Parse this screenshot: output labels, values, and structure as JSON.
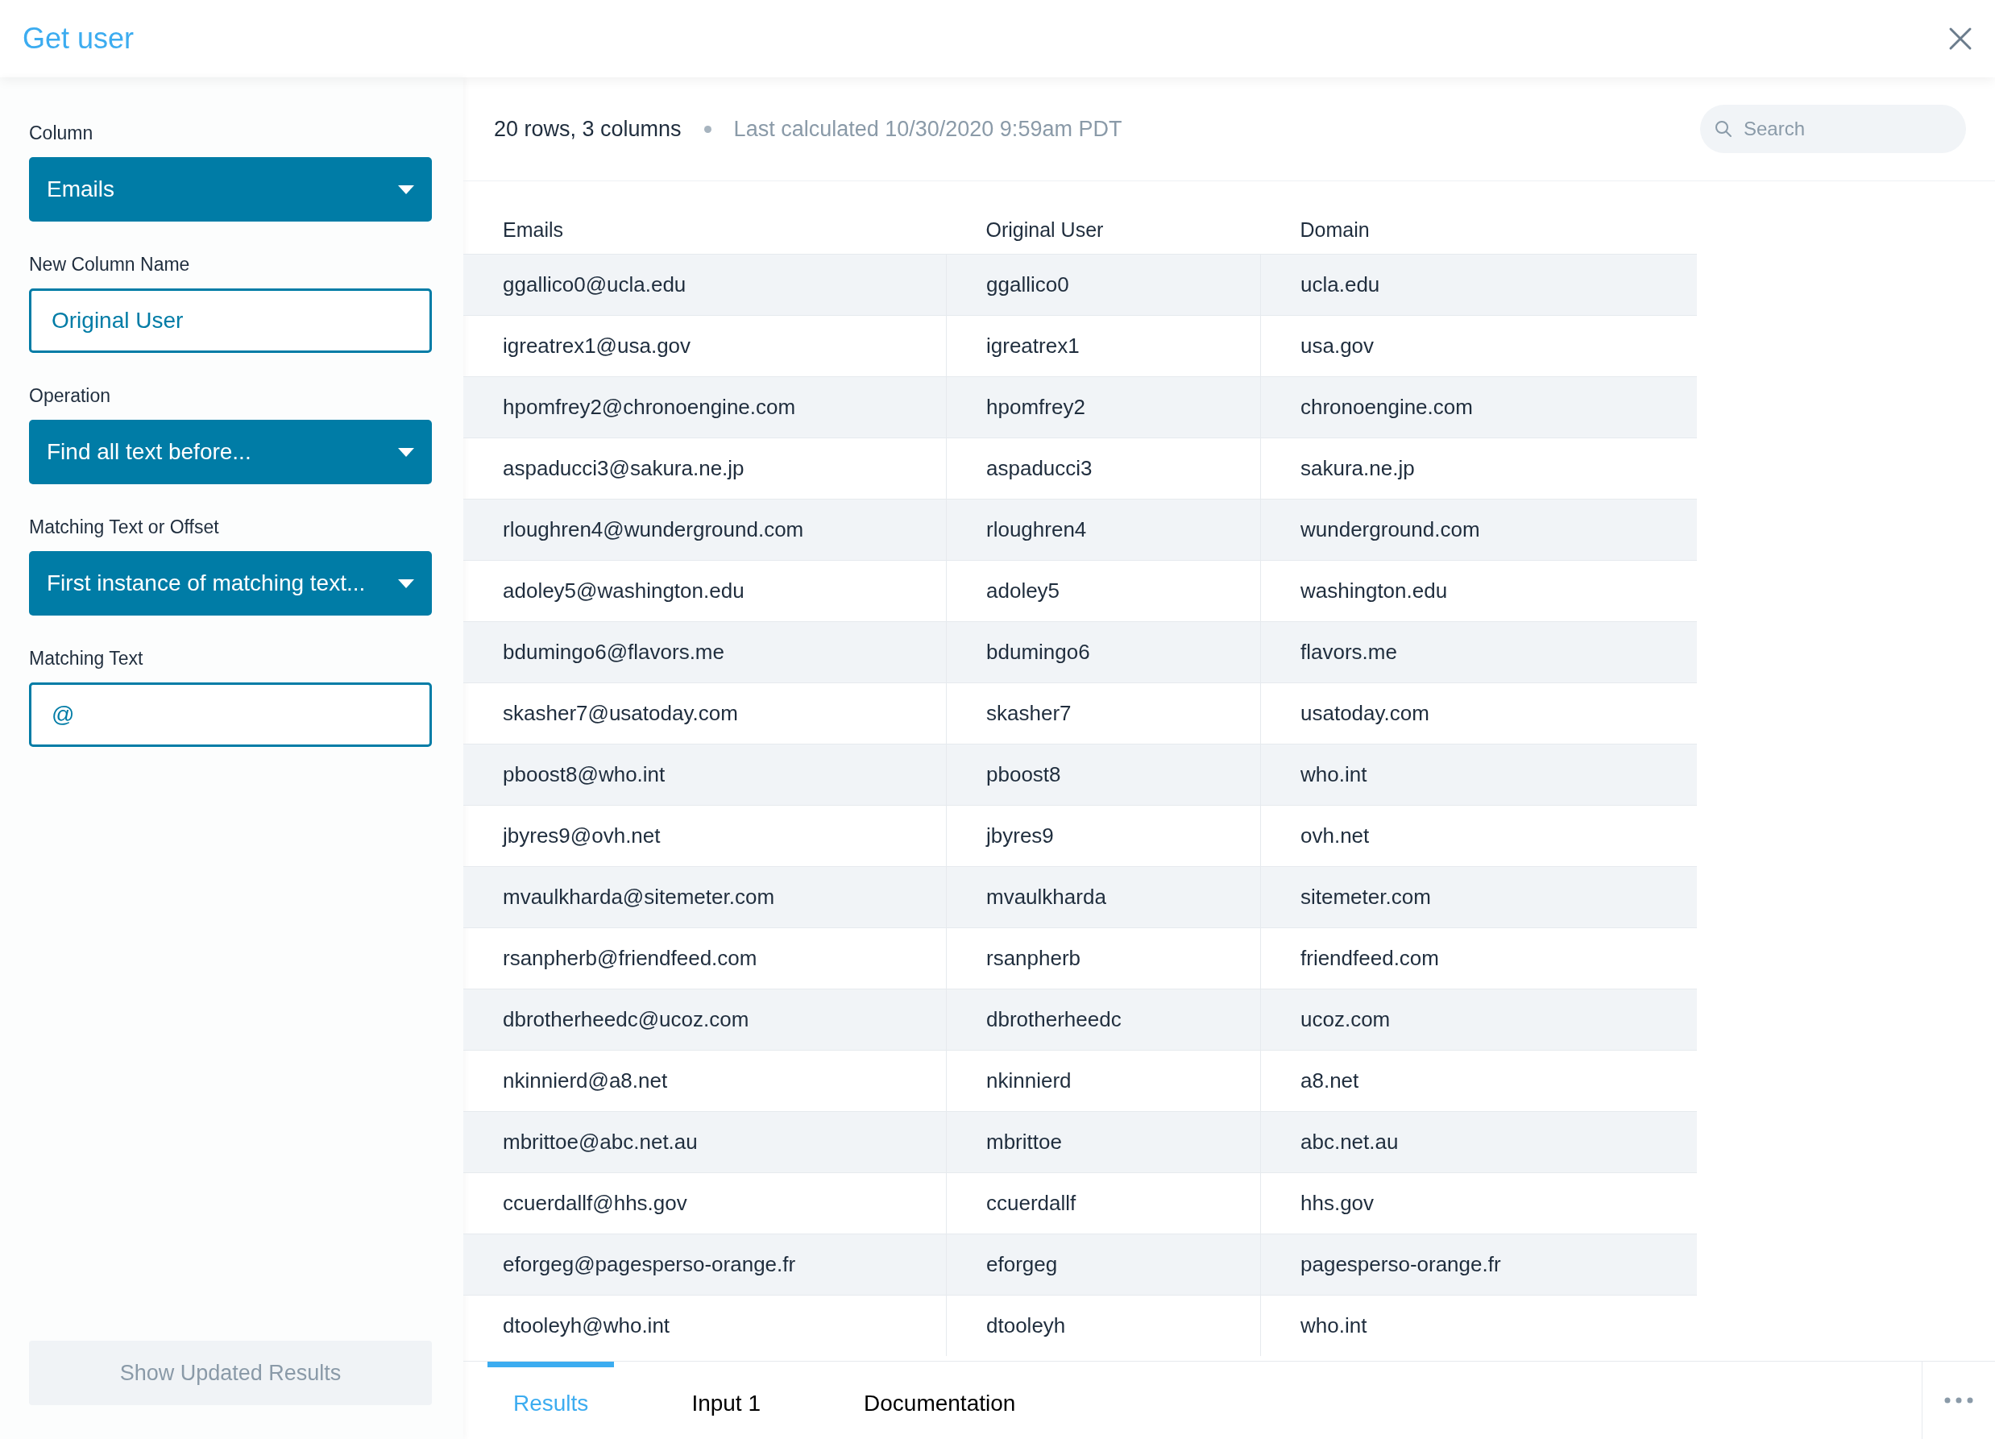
{
  "window": {
    "title": "Get user"
  },
  "sidebar": {
    "fields": [
      {
        "kind": "select",
        "label": "Column",
        "value": "Emails"
      },
      {
        "kind": "input",
        "label": "New Column Name",
        "value": "Original User"
      },
      {
        "kind": "select",
        "label": "Operation",
        "value": "Find all text before..."
      },
      {
        "kind": "select",
        "label": "Matching Text or Offset",
        "value": "First instance of matching text..."
      },
      {
        "kind": "input",
        "label": "Matching Text",
        "value": "@"
      }
    ],
    "button": {
      "label": "Show Updated Results",
      "disabled": true
    }
  },
  "summary": {
    "counts": "20 rows, 3 columns",
    "calculated": "Last calculated 10/30/2020 9:59am PDT"
  },
  "search": {
    "placeholder": "Search"
  },
  "table": {
    "columns": [
      "Emails",
      "Original User",
      "Domain"
    ],
    "rows": [
      [
        "ggallico0@ucla.edu",
        "ggallico0",
        "ucla.edu"
      ],
      [
        "igreatrex1@usa.gov",
        "igreatrex1",
        "usa.gov"
      ],
      [
        "hpomfrey2@chronoengine.com",
        "hpomfrey2",
        "chronoengine.com"
      ],
      [
        "aspaducci3@sakura.ne.jp",
        "aspaducci3",
        "sakura.ne.jp"
      ],
      [
        "rloughren4@wunderground.com",
        "rloughren4",
        "wunderground.com"
      ],
      [
        "adoley5@washington.edu",
        "adoley5",
        "washington.edu"
      ],
      [
        "bdumingo6@flavors.me",
        "bdumingo6",
        "flavors.me"
      ],
      [
        "skasher7@usatoday.com",
        "skasher7",
        "usatoday.com"
      ],
      [
        "pboost8@who.int",
        "pboost8",
        "who.int"
      ],
      [
        "jbyres9@ovh.net",
        "jbyres9",
        "ovh.net"
      ],
      [
        "mvaulkharda@sitemeter.com",
        "mvaulkharda",
        "sitemeter.com"
      ],
      [
        "rsanpherb@friendfeed.com",
        "rsanpherb",
        "friendfeed.com"
      ],
      [
        "dbrotherheedc@ucoz.com",
        "dbrotherheedc",
        "ucoz.com"
      ],
      [
        "nkinnierd@a8.net",
        "nkinnierd",
        "a8.net"
      ],
      [
        "mbrittoe@abc.net.au",
        "mbrittoe",
        "abc.net.au"
      ],
      [
        "ccuerdallf@hhs.gov",
        "ccuerdallf",
        "hhs.gov"
      ],
      [
        "eforgeg@pagesperso-orange.fr",
        "eforgeg",
        "pagesperso-orange.fr"
      ],
      [
        "dtooleyh@who.int",
        "dtooleyh",
        "who.int"
      ]
    ]
  },
  "tabs": [
    {
      "label": "Results",
      "selected": true
    },
    {
      "label": "Input 1",
      "selected": false
    },
    {
      "label": "Documentation",
      "selected": false
    }
  ]
}
